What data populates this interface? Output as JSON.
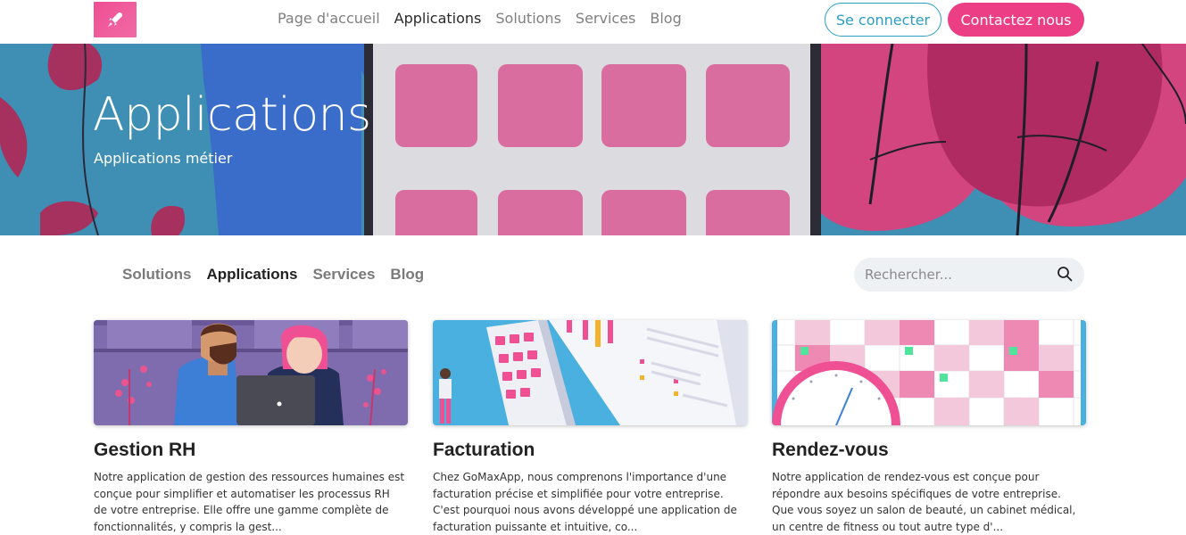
{
  "navbar": {
    "links": [
      "Page d'accueil",
      "Applications",
      "Solutions",
      "Services",
      "Blog"
    ],
    "active": "Applications",
    "login_label": "Se connecter",
    "contact_label": "Contactez nous",
    "logo_icon": "rocket-icon"
  },
  "hero": {
    "title": "Applications",
    "subtitle": "Applications métier"
  },
  "subnav": {
    "links": [
      "Solutions",
      "Applications",
      "Services",
      "Blog"
    ],
    "active": "Applications"
  },
  "search": {
    "placeholder": "Rechercher...",
    "icon": "search-icon"
  },
  "cards": [
    {
      "title": "Gestion RH",
      "description": "Notre application de gestion des ressources humaines est conçue pour simplifier et automatiser les processus RH de votre entreprise. Elle offre une gamme complète de fonctionnalités, y compris la gest..."
    },
    {
      "title": "Facturation",
      "description": "Chez GoMaxApp, nous comprenons l'importance d'une facturation précise et simplifiée pour votre entreprise. C'est pourquoi nous avons développé une application de facturation puissante et intuitive, co..."
    },
    {
      "title": "Rendez-vous",
      "description": "Notre application de rendez-vous est conçue pour répondre aux besoins spécifiques de votre entreprise. Que vous soyez un salon de beauté, un cabinet médical, un centre de fitness ou tout autre type d'..."
    }
  ],
  "colors": {
    "brand_pink": "#ec3e85",
    "brand_blue": "#2b9ec2",
    "hero_blue": "#3f8fb4"
  }
}
